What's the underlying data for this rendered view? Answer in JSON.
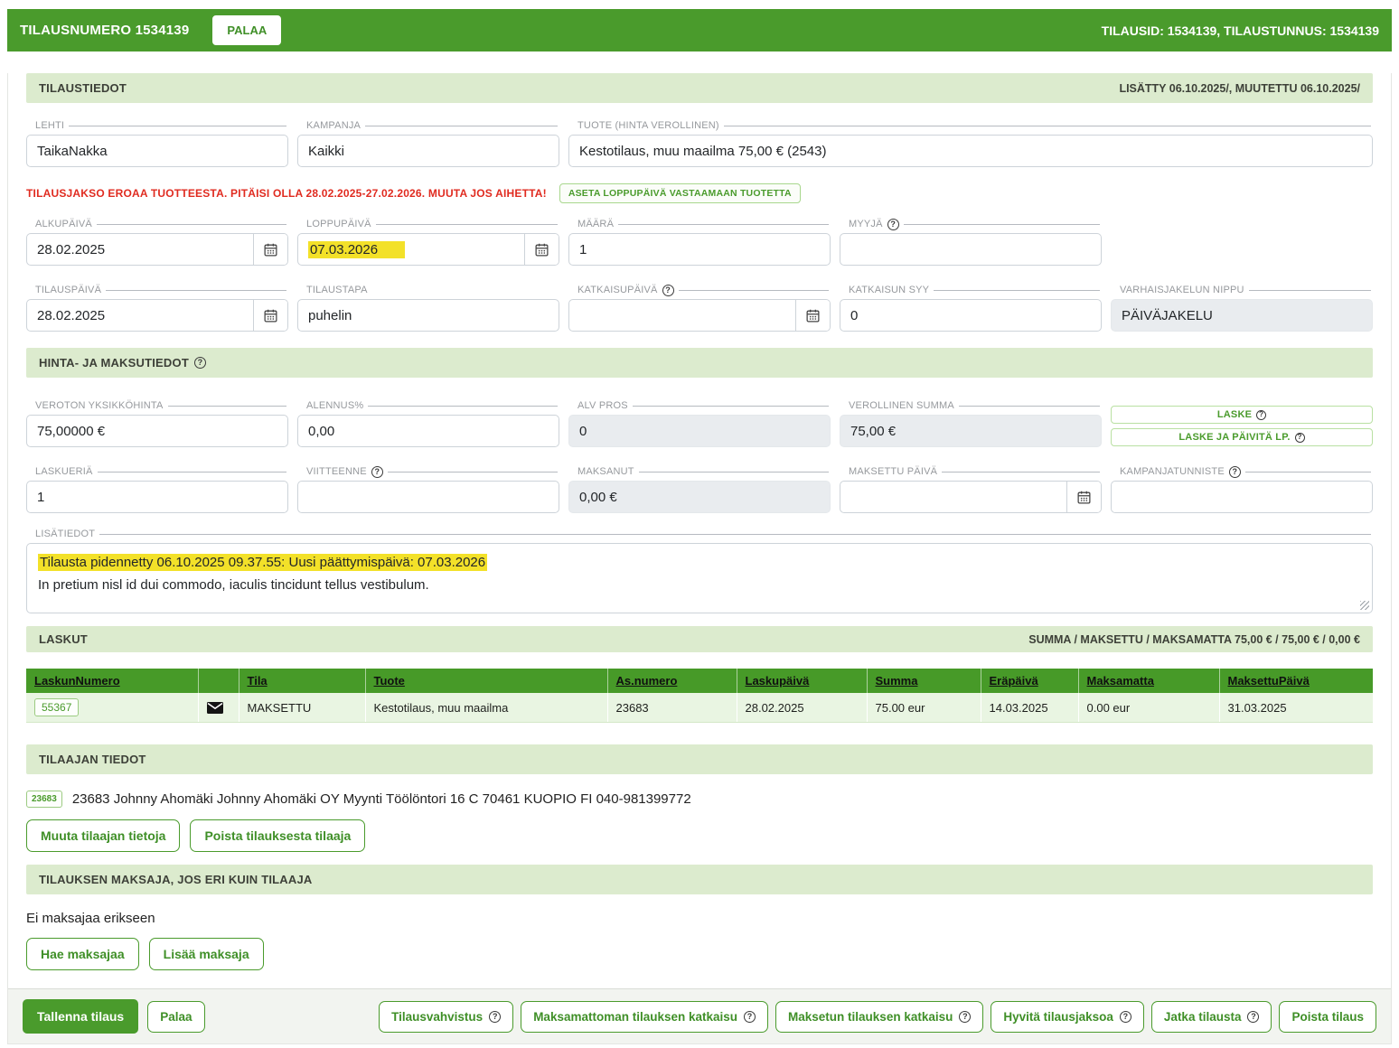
{
  "topbar": {
    "title": "TILAUSNUMERO 1534139",
    "back_label": "PALAA",
    "right_info": "TILAUSID: 1534139, TILAUSTUNNUS: 1534139"
  },
  "tilaustiedot": {
    "title": "TILAUSTIEDOT",
    "meta": "LISÄTTY 06.10.2025/, MUUTETTU 06.10.2025/"
  },
  "warning": {
    "text": "TILAUSJAKSO EROAA TUOTTEESTA. PITÄISI OLLA 28.02.2025-27.02.2026. MUUTA JOS AIHETTA!",
    "action_label": "ASETA LOPPUPÄIVÄ VASTAAMAAN TUOTETTA"
  },
  "fields": {
    "lehti": {
      "label": "LEHTI",
      "value": "TaikaNakka"
    },
    "kampanja": {
      "label": "KAMPANJA",
      "value": "Kaikki"
    },
    "tuote": {
      "label": "TUOTE (HINTA VEROLLINEN)",
      "value": "Kestotilaus, muu maailma 75,00 € (2543)"
    },
    "alkupaiva": {
      "label": "ALKUPÄIVÄ",
      "value": "28.02.2025"
    },
    "loppupaiva": {
      "label": "LOPPUPÄIVÄ",
      "value": "07.03.2026"
    },
    "maara": {
      "label": "MÄÄRÄ",
      "value": "1"
    },
    "myyja": {
      "label": "MYYJÄ",
      "value": ""
    },
    "tilauspaiva": {
      "label": "TILAUSPÄIVÄ",
      "value": "28.02.2025"
    },
    "tilaustapa": {
      "label": "TILAUSTAPA",
      "value": "puhelin"
    },
    "katkaisupaiva": {
      "label": "KATKAISUPÄIVÄ",
      "value": ""
    },
    "katkaisun_syy": {
      "label": "KATKAISUN SYY",
      "value": "0"
    },
    "varhaisjakelun_nippu": {
      "label": "VARHAISJAKELUN NIPPU",
      "value": "PÄIVÄJAKELU"
    },
    "veroton": {
      "label": "VEROTON YKSIKKÖHINTA",
      "value": "75,00000 €"
    },
    "alennus": {
      "label": "ALENNUS%",
      "value": "0,00"
    },
    "alv": {
      "label": "ALV PROS",
      "value": "0"
    },
    "verollinen": {
      "label": "VEROLLINEN SUMMA",
      "value": "75,00 €"
    },
    "laskueria": {
      "label": "LASKUERIÄ",
      "value": "1"
    },
    "viitteenne": {
      "label": "VIITTEENNE",
      "value": ""
    },
    "maksanut": {
      "label": "MAKSANUT",
      "value": "0,00 €"
    },
    "maksettu_paiva": {
      "label": "MAKSETTU PÄIVÄ",
      "value": ""
    },
    "kampanjatunniste": {
      "label": "KAMPANJATUNNISTE",
      "value": ""
    },
    "lisatiedot": {
      "label": "LISÄTIEDOT",
      "line1": "Tilausta pidennetty 06.10.2025 09.37.55: Uusi päättymispäivä: 07.03.2026",
      "line2": "In pretium nisl id dui commodo, iaculis tincidunt tellus vestibulum."
    }
  },
  "hinta": {
    "title": "HINTA- JA MAKSUTIEDOT",
    "laske_label": "LASKE",
    "laske_paivita_label": "LASKE JA PÄIVITÄ LP."
  },
  "laskut": {
    "title": "LASKUT",
    "summary": "SUMMA / MAKSETTU / MAKSAMATTA 75,00 € / 75,00 € / 0,00 €",
    "headers": [
      "LaskunNumero",
      "",
      "Tila",
      "Tuote",
      "As.numero",
      "Laskupäivä",
      "Summa",
      "Eräpäivä",
      "Maksamatta",
      "MaksettuPäivä"
    ],
    "row": {
      "laskunnumero": "55367",
      "tila": "MAKSETTU",
      "tuote": "Kestotilaus, muu maailma",
      "asnumero": "23683",
      "laskupaiva": "28.02.2025",
      "summa": "75.00 eur",
      "erapaiva": "14.03.2025",
      "maksamatta": "0.00 eur",
      "maksettupaiva": "31.03.2025"
    }
  },
  "tilaaja": {
    "title": "TILAAJAN TIEDOT",
    "badge": "23683",
    "info": "23683 Johnny Ahomäki Johnny Ahomäki OY Myynti Töölöntori 16 C 70461 KUOPIO FI 040-981399772",
    "muuta_label": "Muuta tilaajan tietoja",
    "poista_label": "Poista tilauksesta tilaaja"
  },
  "maksaja": {
    "title": "TILAUKSEN MAKSAJA, JOS ERI KUIN TILAAJA",
    "note": "Ei maksajaa erikseen",
    "hae_label": "Hae maksajaa",
    "lisaa_label": "Lisää maksaja"
  },
  "footer": {
    "save_label": "Tallenna tilaus",
    "back_label": "Palaa",
    "actions": [
      {
        "label": "Tilausvahvistus",
        "help": true
      },
      {
        "label": "Maksamattoman tilauksen katkaisu",
        "help": true
      },
      {
        "label": "Maksetun tilauksen katkaisu",
        "help": true
      },
      {
        "label": "Hyvitä tilausjaksoa",
        "help": true
      },
      {
        "label": "Jatka tilausta",
        "help": true
      },
      {
        "label": "Poista tilaus",
        "help": false
      }
    ]
  },
  "colors": {
    "primary_green": "#4a9b2c",
    "section_header_bg": "#dcebce",
    "table_row_green": "#e9f5e2",
    "highlight_yellow": "#f3e129",
    "warning_red": "#e02b20",
    "disabled_bg": "#e9ecef"
  },
  "icons": {
    "calendar": "calendar-icon",
    "envelope": "envelope-icon",
    "help": "help-icon"
  }
}
